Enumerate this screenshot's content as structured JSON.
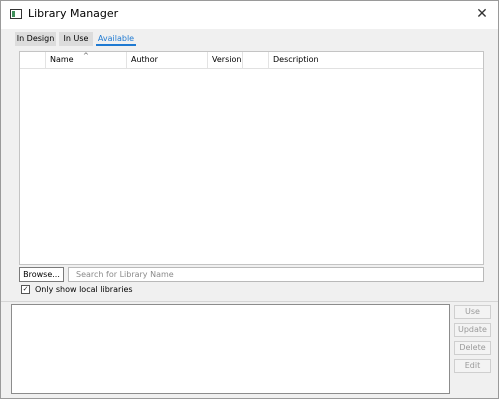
{
  "window": {
    "title": "Library Manager"
  },
  "tabs": [
    {
      "label": "In Design"
    },
    {
      "label": "In Use"
    },
    {
      "label": "Available",
      "active": true
    }
  ],
  "table": {
    "columns": [
      "Name",
      "Author",
      "Version",
      "Description"
    ],
    "rows": []
  },
  "search": {
    "browse_label": "Browse...",
    "placeholder": "Search for Library Name",
    "value": ""
  },
  "filter": {
    "label": "Only show local libraries",
    "checked": true
  },
  "actions": {
    "use": "Use",
    "update": "Update",
    "delete": "Delete",
    "edit": "Edit"
  },
  "colors": {
    "accent": "#1f7ad2",
    "disabled_text": "#9a9a9a"
  }
}
